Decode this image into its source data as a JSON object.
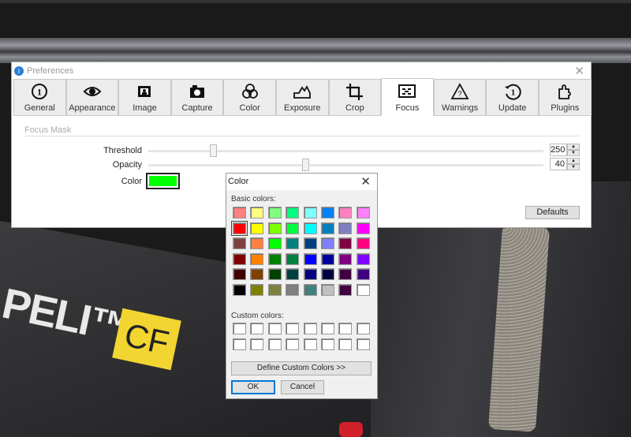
{
  "photo": {
    "logo_text": "PELI™",
    "badge_text": "CF"
  },
  "preferences": {
    "title": "Preferences",
    "tabs": [
      {
        "label": "General",
        "icon": "general-icon"
      },
      {
        "label": "Appearance",
        "icon": "eye-icon"
      },
      {
        "label": "Image",
        "icon": "image-icon"
      },
      {
        "label": "Capture",
        "icon": "camera-icon"
      },
      {
        "label": "Color",
        "icon": "color-circles-icon"
      },
      {
        "label": "Exposure",
        "icon": "histogram-icon"
      },
      {
        "label": "Crop",
        "icon": "crop-icon"
      },
      {
        "label": "Focus",
        "icon": "focus-icon",
        "active": true
      },
      {
        "label": "Warnings",
        "icon": "warning-icon"
      },
      {
        "label": "Update",
        "icon": "update-icon"
      },
      {
        "label": "Plugins",
        "icon": "puzzle-icon"
      }
    ],
    "section": "Focus Mask",
    "threshold": {
      "label": "Threshold",
      "value": "250"
    },
    "opacity": {
      "label": "Opacity",
      "value": "40"
    },
    "color": {
      "label": "Color",
      "value": "#00FF00"
    },
    "defaults": "Defaults"
  },
  "color_dialog": {
    "title": "Color",
    "basic_label": "Basic colors:",
    "basic_colors": [
      [
        "#FF8080",
        "#FFFF80",
        "#80FF80",
        "#00FF80",
        "#80FFFF",
        "#0080FF",
        "#FF80C0",
        "#FF80FF"
      ],
      [
        "#FF0000",
        "#FFFF00",
        "#80FF00",
        "#00FF40",
        "#00FFFF",
        "#0080C0",
        "#8080C0",
        "#FF00FF"
      ],
      [
        "#804040",
        "#FF8040",
        "#00FF00",
        "#008080",
        "#004080",
        "#8080FF",
        "#800040",
        "#FF0080"
      ],
      [
        "#800000",
        "#FF8000",
        "#008000",
        "#008040",
        "#0000FF",
        "#0000A0",
        "#800080",
        "#8000FF"
      ],
      [
        "#400000",
        "#804000",
        "#004000",
        "#004040",
        "#000080",
        "#000040",
        "#400040",
        "#400080"
      ],
      [
        "#000000",
        "#808000",
        "#808040",
        "#808080",
        "#408080",
        "#C0C0C0",
        "#400040",
        "#FFFFFF"
      ]
    ],
    "selected_color": "#FF0000",
    "custom_label": "Custom colors:",
    "define_button": "Define Custom Colors >>",
    "ok": "OK",
    "cancel": "Cancel"
  }
}
